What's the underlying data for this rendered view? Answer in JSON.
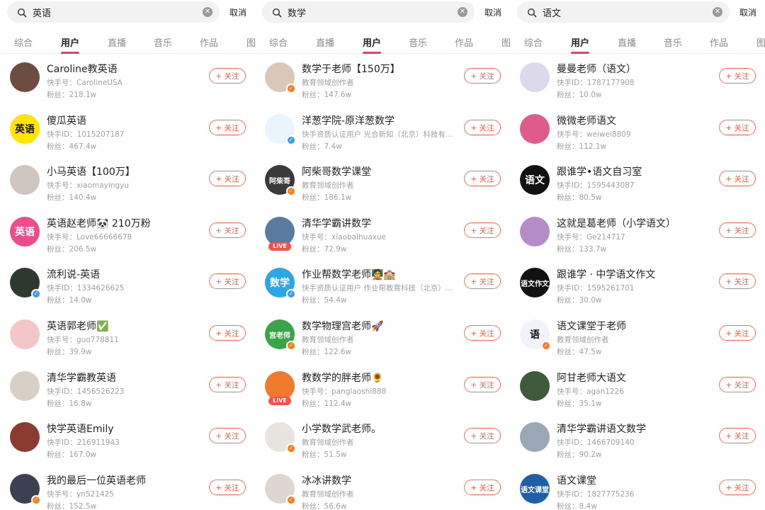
{
  "panels": [
    {
      "search": {
        "query": "英语",
        "cancel_label": "取消"
      },
      "tabs": [
        {
          "label": "综合",
          "active": false
        },
        {
          "label": "用户",
          "active": true
        },
        {
          "label": "直播",
          "active": false
        },
        {
          "label": "音乐",
          "active": false
        },
        {
          "label": "作品",
          "active": false
        },
        {
          "label": "图",
          "active": false
        }
      ],
      "follow_label": "+ 关注",
      "users": [
        {
          "name": "Caroline教英语",
          "uid": "快手号：CarolineUSA",
          "fans": "粉丝：218.1w",
          "avatar_text": "",
          "avatar_color": "#6d4c41",
          "badge": "none",
          "live": false
        },
        {
          "name": "傻瓜英语",
          "uid": "快手ID：1015207187",
          "fans": "粉丝：467.4w",
          "avatar_text": "英语",
          "avatar_color": "#ffe600",
          "badge": "none",
          "live": false
        },
        {
          "name": "小马英语【100万】",
          "uid": "快手号：xiaomayingyu",
          "fans": "粉丝：140.4w",
          "avatar_text": "",
          "avatar_color": "#cfc7bf",
          "badge": "none",
          "live": false
        },
        {
          "name": "英语赵老师🐼 210万粉",
          "uid": "快手号：Love66666678",
          "fans": "粉丝：206.5w",
          "avatar_text": "英语",
          "avatar_color": "#f04b8a",
          "badge": "none",
          "live": false
        },
        {
          "name": "流利说-英语",
          "uid": "快手ID：1334626625",
          "fans": "粉丝：14.0w",
          "avatar_text": "",
          "avatar_color": "#2e3a2f",
          "badge": "blue",
          "live": false
        },
        {
          "name": "英语郭老师✅",
          "uid": "快手号：guo778811",
          "fans": "粉丝：39.9w",
          "avatar_text": "",
          "avatar_color": "#f3c7c7",
          "badge": "none",
          "live": false
        },
        {
          "name": "清华学霸教英语",
          "uid": "快手ID：1456526223",
          "fans": "粉丝：16.8w",
          "avatar_text": "",
          "avatar_color": "#d8cfc6",
          "badge": "none",
          "live": false
        },
        {
          "name": "快学英语Emily",
          "uid": "快手ID：216911943",
          "fans": "粉丝：167.0w",
          "avatar_text": "",
          "avatar_color": "#8a3a2e",
          "badge": "none",
          "live": false
        },
        {
          "name": "我的最后一位英语老师",
          "uid": "快手号：yn521425",
          "fans": "粉丝：152.5w",
          "avatar_text": "",
          "avatar_color": "#3b4150",
          "badge": "orange",
          "live": false
        }
      ]
    },
    {
      "search": {
        "query": "数学",
        "cancel_label": "取消"
      },
      "tabs": [
        {
          "label": "综合",
          "active": false
        },
        {
          "label": "直播",
          "active": false
        },
        {
          "label": "用户",
          "active": true
        },
        {
          "label": "音乐",
          "active": false
        },
        {
          "label": "作品",
          "active": false
        },
        {
          "label": "图",
          "active": false
        }
      ],
      "follow_label": "+ 关注",
      "users": [
        {
          "name": "数学于老师【150万】",
          "uid": "教育领域创作者",
          "fans": "粉丝：147.6w",
          "avatar_text": "",
          "avatar_color": "#d9c8b8",
          "badge": "orange",
          "live": false
        },
        {
          "name": "洋葱学院-原洋葱数学",
          "uid": "快手资质认证用户 光合新知（北京）科技有…",
          "fans": "粉丝：7.4w",
          "avatar_text": "",
          "avatar_color": "#e9f4fd",
          "badge": "blue",
          "live": false
        },
        {
          "name": "阿柴哥数学课堂",
          "uid": "教育领域创作者",
          "fans": "粉丝：186.1w",
          "avatar_text": "阿柴哥",
          "avatar_color": "#3a3a3a",
          "badge": "orange",
          "live": false
        },
        {
          "name": "清华学霸讲数学",
          "uid": "快手号：xiaobaihuaxue",
          "fans": "粉丝：72.9w",
          "avatar_text": "",
          "avatar_color": "#5a7aa0",
          "badge": "none",
          "live": true
        },
        {
          "name": "作业帮数学老师🧑‍🏫🏫",
          "uid": "快手资质认证用户 作业帮教育科技（北京）…",
          "fans": "粉丝：54.4w",
          "avatar_text": "数学",
          "avatar_color": "#29a7e8",
          "badge": "blue",
          "live": false
        },
        {
          "name": "数学物理宫老师🚀",
          "uid": "教育领域创作者",
          "fans": "粉丝：122.6w",
          "avatar_text": "宫老师",
          "avatar_color": "#3aa548",
          "badge": "orange",
          "live": false
        },
        {
          "name": "教数学的胖老师🌻",
          "uid": "快手号：panglaoshi888",
          "fans": "粉丝：112.4w",
          "avatar_text": "",
          "avatar_color": "#f07b2e",
          "badge": "none",
          "live": true
        },
        {
          "name": "小学数学武老师。",
          "uid": "教育领域创作者",
          "fans": "粉丝：51.5w",
          "avatar_text": "",
          "avatar_color": "#e8e4e0",
          "badge": "orange",
          "live": false
        },
        {
          "name": "冰冰讲数学",
          "uid": "教育领域创作者",
          "fans": "粉丝：56.6w",
          "avatar_text": "",
          "avatar_color": "#ddd6d0",
          "badge": "orange",
          "live": false
        }
      ]
    },
    {
      "search": {
        "query": "语文",
        "cancel_label": "取消"
      },
      "tabs": [
        {
          "label": "综合",
          "active": false
        },
        {
          "label": "用户",
          "active": true
        },
        {
          "label": "直播",
          "active": false
        },
        {
          "label": "音乐",
          "active": false
        },
        {
          "label": "作品",
          "active": false
        },
        {
          "label": "图",
          "active": false
        }
      ],
      "follow_label": "+ 关注",
      "users": [
        {
          "name": "曼曼老师（语文）",
          "uid": "快手ID：1787177908",
          "fans": "粉丝：10.0w",
          "avatar_text": "",
          "avatar_color": "#dcd9ec",
          "badge": "none",
          "live": false
        },
        {
          "name": "微微老师语文",
          "uid": "快手号：weiwei8809",
          "fans": "粉丝：112.1w",
          "avatar_text": "",
          "avatar_color": "#e05a8a",
          "badge": "none",
          "live": false
        },
        {
          "name": "跟谁学•语文自习室",
          "uid": "快手ID：1595443087",
          "fans": "粉丝：80.5w",
          "avatar_text": "语文",
          "avatar_color": "#111111",
          "badge": "none",
          "live": false
        },
        {
          "name": "这就是葛老师（小学语文）",
          "uid": "快手号：Ge214717",
          "fans": "粉丝：133.7w",
          "avatar_text": "",
          "avatar_color": "#b48cc8",
          "badge": "none",
          "live": false
        },
        {
          "name": "跟谁学 · 中学语文作文",
          "uid": "快手ID：1595261701",
          "fans": "粉丝：30.0w",
          "avatar_text": "语文作文",
          "avatar_color": "#111111",
          "badge": "none",
          "live": false
        },
        {
          "name": "语文课堂于老师",
          "uid": "教育领域创作者",
          "fans": "粉丝：47.5w",
          "avatar_text": "语",
          "avatar_color": "#f0f4fa",
          "badge": "orange",
          "live": false
        },
        {
          "name": "阿甘老师大语文",
          "uid": "快手号：agan1226",
          "fans": "粉丝：35.1w",
          "avatar_text": "",
          "avatar_color": "#3d5a3a",
          "badge": "none",
          "live": false
        },
        {
          "name": "清华学霸讲语文数学",
          "uid": "快手ID：1466709140",
          "fans": "粉丝：90.2w",
          "avatar_text": "",
          "avatar_color": "#9aa7b5",
          "badge": "none",
          "live": false
        },
        {
          "name": "语文课堂",
          "uid": "快手ID：1827775236",
          "fans": "粉丝：8.4w",
          "avatar_text": "语文课堂",
          "avatar_color": "#1f5fa8",
          "badge": "none",
          "live": false
        }
      ]
    }
  ]
}
